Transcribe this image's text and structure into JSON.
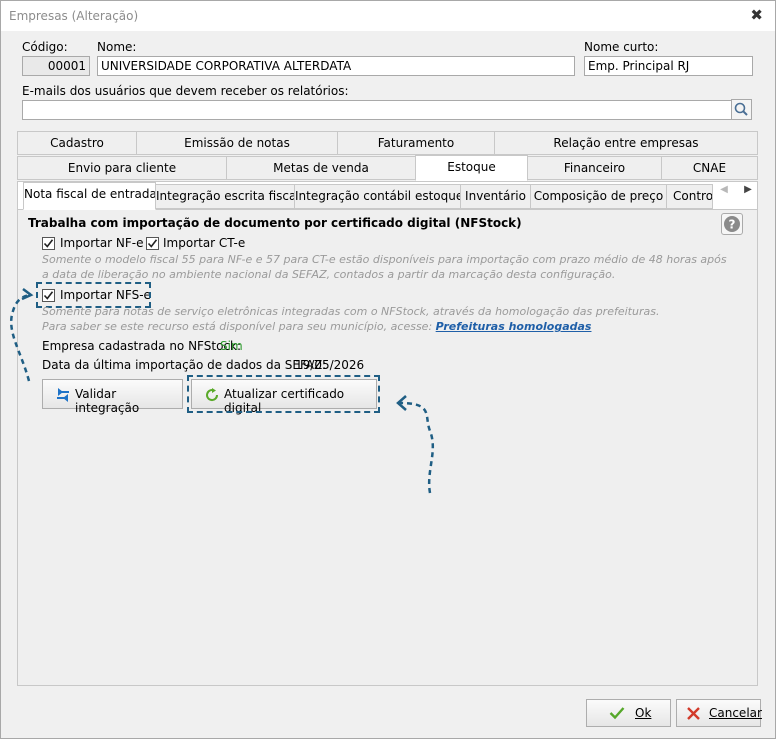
{
  "window": {
    "title": "Empresas (Alteração)",
    "close_label": "✖"
  },
  "form": {
    "codigo_label": "Código:",
    "codigo_value": "00001",
    "nome_label": "Nome:",
    "nome_value": "UNIVERSIDADE CORPORATIVA ALTERDATA",
    "nome_curto_label": "Nome curto:",
    "nome_curto_value": "Emp. Principal RJ",
    "emails_label": "E-mails dos usuários que devem receber os relatórios:",
    "emails_value": ""
  },
  "tabs_row1": [
    "Cadastro",
    "Emissão de notas",
    "Faturamento",
    "Relação entre empresas"
  ],
  "tabs_row2": [
    "Envio para cliente",
    "Metas de venda",
    "Estoque",
    "Financeiro",
    "CNAE"
  ],
  "active_tab_row2": "Estoque",
  "subtabs": [
    "Nota fiscal de entrada",
    "Integração escrita fiscal",
    "Integração contábil estoque",
    "Inventário",
    "Composição de preço",
    "Contro"
  ],
  "active_subtab": "Nota fiscal de entrada",
  "content": {
    "section_title": "Trabalha com importação de documento por certificado digital (NFStock)",
    "nfe_label": "Importar NF-e",
    "nfe_checked": true,
    "cte_label": "Importar CT-e",
    "cte_checked": true,
    "hint1_line1": "Somente o modelo fiscal 55 para NF-e e 57 para CT-e estão disponíveis para importação com prazo médio de 48 horas após",
    "hint1_line2": "a data de liberação no ambiente nacional da SEFAZ, contados a partir da marcação desta configuração.",
    "nfse_label": "Importar NFS-e",
    "nfse_checked": true,
    "hint2_line1": "Somente para notas de serviço eletrônicas integradas com o NFStock, através da homologação das prefeituras.",
    "hint2_line2": "Para saber se este recurso está disponível para seu município, acesse:",
    "hint2_link": "Prefeituras homologadas",
    "empresa_label": "Empresa cadastrada no NFStock:",
    "empresa_value": "Sim",
    "data_label": "Data da última importação de dados da SEFAZ:",
    "data_value": "19/05/2026",
    "btn_validar": "Validar integração",
    "btn_atualizar": "Atualizar certificado digital"
  },
  "footer": {
    "ok": "Ok",
    "cancelar": "Cancelar"
  },
  "colors": {
    "accent_dash": "#1f5e84",
    "link": "#1f5fa8",
    "success": "#2e9a2e",
    "cancel": "#d23a2a"
  }
}
